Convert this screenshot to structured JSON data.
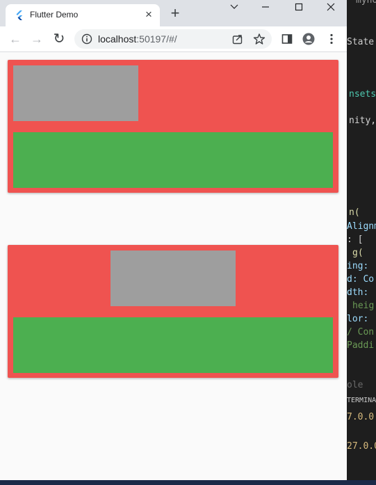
{
  "browser": {
    "tab": {
      "title": "Flutter Demo",
      "close": "×"
    },
    "new_tab": "+",
    "window_controls": {
      "minimize": "⌵",
      "maximize": "☐",
      "close": "✕"
    },
    "nav": {
      "back": "←",
      "forward": "→",
      "reload": "↻"
    },
    "address": {
      "host": "localhost",
      "path": ":50197/#/"
    }
  },
  "page": {
    "card_color": "#ef5350",
    "box_gray": "#9e9e9e",
    "box_green": "#4caf50",
    "cards": [
      {
        "alignment": "left"
      },
      {
        "alignment": "center"
      }
    ]
  },
  "editor": {
    "lines": [
      {
        "text": "myho",
        "color": "#9d9d9d"
      },
      {
        "text": "State >",
        "color": "#cccccc"
      },
      {
        "text": "nsets",
        "color": "#4ec9b0"
      },
      {
        "text": "nity,",
        "color": "#d4d4d4"
      },
      {
        "text": "n(",
        "color": "#dcdcaa"
      },
      {
        "text": "Alignm",
        "color": "#9cdcfe"
      },
      {
        "text": ": [",
        "color": "#d4d4d4"
      },
      {
        "text": "g(",
        "color": "#dcdcaa"
      },
      {
        "text": "ing:",
        "color": "#9cdcfe"
      },
      {
        "text": "d: Co",
        "color": "#9cdcfe"
      },
      {
        "text": "dth:",
        "color": "#9cdcfe"
      },
      {
        "text": "heig",
        "color": "#6a9955"
      },
      {
        "text": "lor:",
        "color": "#9cdcfe"
      },
      {
        "text": "/ Con",
        "color": "#6a9955"
      },
      {
        "text": "Paddi",
        "color": "#6a9955"
      },
      {
        "text": "ole",
        "color": "#6a6a6a"
      },
      {
        "text": "TERMINA",
        "color": "#cccccc"
      },
      {
        "text": "7.0.0.",
        "color": "#d7ba7d"
      },
      {
        "text": "27.0.0",
        "color": "#d7ba7d"
      }
    ]
  }
}
